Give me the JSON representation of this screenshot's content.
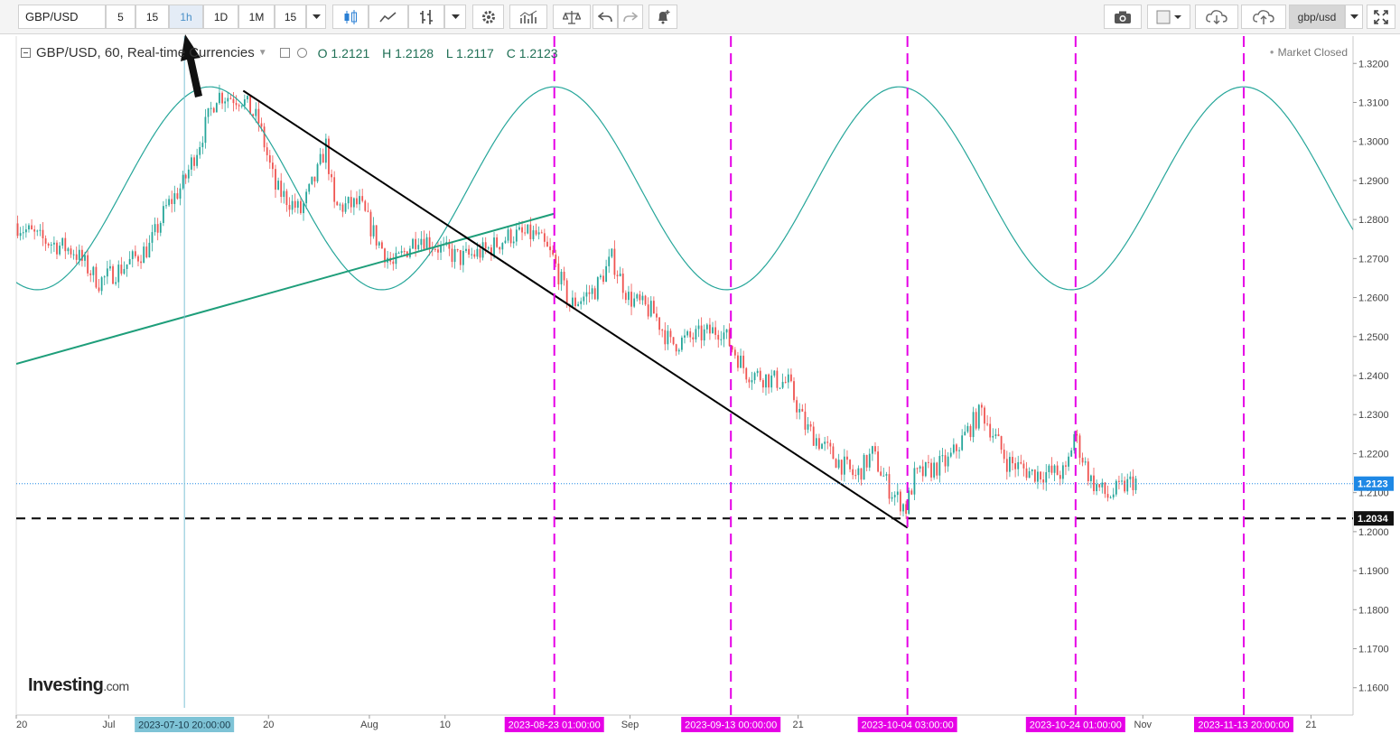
{
  "toolbar": {
    "symbol": "GBP/USD",
    "intervals": [
      "5",
      "15",
      "1h",
      "1D",
      "1M",
      "15"
    ],
    "active_interval": "1h",
    "search_value": "gbp/usd"
  },
  "legend": {
    "title": "GBP/USD, 60, Real-time Currencies",
    "open": "O 1.2121",
    "high": "H 1.2128",
    "low": "L 1.2117",
    "close": "C 1.2123"
  },
  "market_status": "Market Closed",
  "logo": {
    "main": "Investing",
    "suffix": ".com"
  },
  "colors": {
    "up": "#26a69a",
    "down": "#ef5350",
    "sine": "#26a69a",
    "support_line": "#1e9e7a",
    "trend_line": "#000000",
    "cycle_marker": "#e600e6",
    "price_label_bg": "#1e88e5",
    "time_label_bg": "#e600e6",
    "crosshair_label_bg": "#7ec3d6"
  },
  "chart_data": {
    "type": "candlestick",
    "symbol": "GBP/USD",
    "interval": "60",
    "x_range": [
      "2023-06-20",
      "2023-11-26"
    ],
    "ylim": [
      1.153,
      1.327
    ],
    "yticks": [
      1.16,
      1.17,
      1.18,
      1.19,
      1.2,
      1.21,
      1.22,
      1.23,
      1.24,
      1.25,
      1.26,
      1.27,
      1.28,
      1.29,
      1.3,
      1.31,
      1.32
    ],
    "ytick_labels": [
      "1.1600",
      "1.1700",
      "1.1800",
      "1.1900",
      "1.2000",
      "1.2100",
      "1.2200",
      "1.2300",
      "1.2400",
      "1.2500",
      "1.2600",
      "1.2700",
      "1.2800",
      "1.2900",
      "1.3000",
      "1.3100",
      "1.3200"
    ],
    "xticks": [
      {
        "date": "2023-06-20",
        "label": "20"
      },
      {
        "date": "2023-07-01",
        "label": "Jul"
      },
      {
        "date": "2023-07-20",
        "label": "20"
      },
      {
        "date": "2023-08-01",
        "label": "Aug"
      },
      {
        "date": "2023-08-10",
        "label": "10"
      },
      {
        "date": "2023-09-01",
        "label": "Sep"
      },
      {
        "date": "2023-09-21",
        "label": "21"
      },
      {
        "date": "2023-11-01",
        "label": "Nov"
      },
      {
        "date": "2023-11-21",
        "label": "21"
      }
    ],
    "price_path": [
      [
        "2023-06-20",
        1.279
      ],
      [
        "2023-06-23",
        1.275
      ],
      [
        "2023-06-27",
        1.272
      ],
      [
        "2023-06-30",
        1.264
      ],
      [
        "2023-07-03",
        1.268
      ],
      [
        "2023-07-06",
        1.273
      ],
      [
        "2023-07-08",
        1.283
      ],
      [
        "2023-07-10",
        1.289
      ],
      [
        "2023-07-12",
        1.3
      ],
      [
        "2023-07-14",
        1.312
      ],
      [
        "2023-07-17",
        1.311
      ],
      [
        "2023-07-19",
        1.305
      ],
      [
        "2023-07-21",
        1.288
      ],
      [
        "2023-07-24",
        1.282
      ],
      [
        "2023-07-26",
        1.292
      ],
      [
        "2023-07-27",
        1.299
      ],
      [
        "2023-07-28",
        1.283
      ],
      [
        "2023-07-31",
        1.284
      ],
      [
        "2023-08-02",
        1.275
      ],
      [
        "2023-08-04",
        1.268
      ],
      [
        "2023-08-07",
        1.276
      ],
      [
        "2023-08-10",
        1.272
      ],
      [
        "2023-08-12",
        1.27
      ],
      [
        "2023-08-15",
        1.272
      ],
      [
        "2023-08-18",
        1.276
      ],
      [
        "2023-08-21",
        1.276
      ],
      [
        "2023-08-23",
        1.27
      ],
      [
        "2023-08-25",
        1.258
      ],
      [
        "2023-08-28",
        1.262
      ],
      [
        "2023-08-30",
        1.27
      ],
      [
        "2023-09-01",
        1.26
      ],
      [
        "2023-09-04",
        1.256
      ],
      [
        "2023-09-06",
        1.248
      ],
      [
        "2023-09-09",
        1.25
      ],
      [
        "2023-09-12",
        1.252
      ],
      [
        "2023-09-15",
        1.241
      ],
      [
        "2023-09-18",
        1.239
      ],
      [
        "2023-09-20",
        1.238
      ],
      [
        "2023-09-22",
        1.227
      ],
      [
        "2023-09-25",
        1.22
      ],
      [
        "2023-09-28",
        1.214
      ],
      [
        "2023-09-30",
        1.22
      ],
      [
        "2023-10-02",
        1.211
      ],
      [
        "2023-10-04",
        1.206
      ],
      [
        "2023-10-05",
        1.214
      ],
      [
        "2023-10-09",
        1.218
      ],
      [
        "2023-10-12",
        1.228
      ],
      [
        "2023-10-13",
        1.231
      ],
      [
        "2023-10-16",
        1.218
      ],
      [
        "2023-10-19",
        1.215
      ],
      [
        "2023-10-23",
        1.215
      ],
      [
        "2023-10-24",
        1.225
      ],
      [
        "2023-10-26",
        1.213
      ],
      [
        "2023-10-28",
        1.209
      ],
      [
        "2023-10-31",
        1.213
      ]
    ],
    "last_price": 1.2123,
    "last_price_label": "1.2123",
    "support_level": 1.2034,
    "support_label": "1.2034",
    "trend_line": {
      "from": [
        "2023-07-17",
        1.313
      ],
      "to": [
        "2023-10-04",
        1.201
      ]
    },
    "rising_line": {
      "from": [
        "2023-06-20",
        1.243
      ],
      "to": [
        "2023-08-23",
        1.2815
      ]
    },
    "sine_wave": {
      "center": 1.288,
      "amplitude": 0.026,
      "period_days": 41,
      "peak_date": "2023-07-13"
    },
    "cycle_markers": [
      {
        "date": "2023-08-23",
        "label": "2023-08-23 01:00:00"
      },
      {
        "date": "2023-09-13",
        "label": "2023-09-13 00:00:00"
      },
      {
        "date": "2023-10-04",
        "label": "2023-10-04 03:00:00"
      },
      {
        "date": "2023-10-24",
        "label": "2023-10-24 01:00:00"
      },
      {
        "date": "2023-11-13",
        "label": "2023-11-13 20:00:00"
      }
    ],
    "crosshair": {
      "date": "2023-07-10",
      "label": "2023-07-10 20:00:00"
    }
  }
}
